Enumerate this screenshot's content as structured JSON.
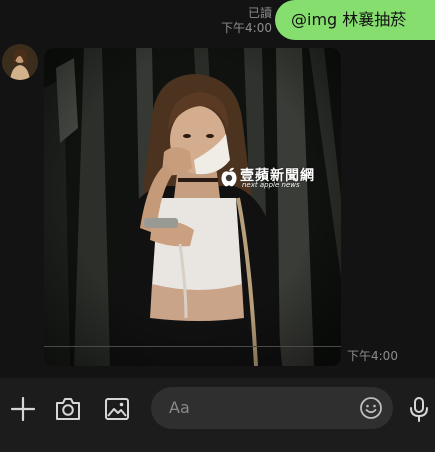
{
  "chat": {
    "sent": {
      "read_label": "已讀",
      "time": "下午4:00",
      "text": "@img 林襄抽菸"
    },
    "received": {
      "time": "下午4:00",
      "watermark_title": "壹蘋新聞網",
      "watermark_subtitle": "next apple news"
    }
  },
  "composer": {
    "placeholder": "Aa",
    "icons": [
      "plus-icon",
      "camera-icon",
      "image-icon",
      "emoji-icon",
      "microphone-icon"
    ]
  },
  "colors": {
    "background": "#131313",
    "sent_bubble": "#86de6f",
    "toolbar": "#1c1c1c",
    "input": "#2f2f2f"
  }
}
